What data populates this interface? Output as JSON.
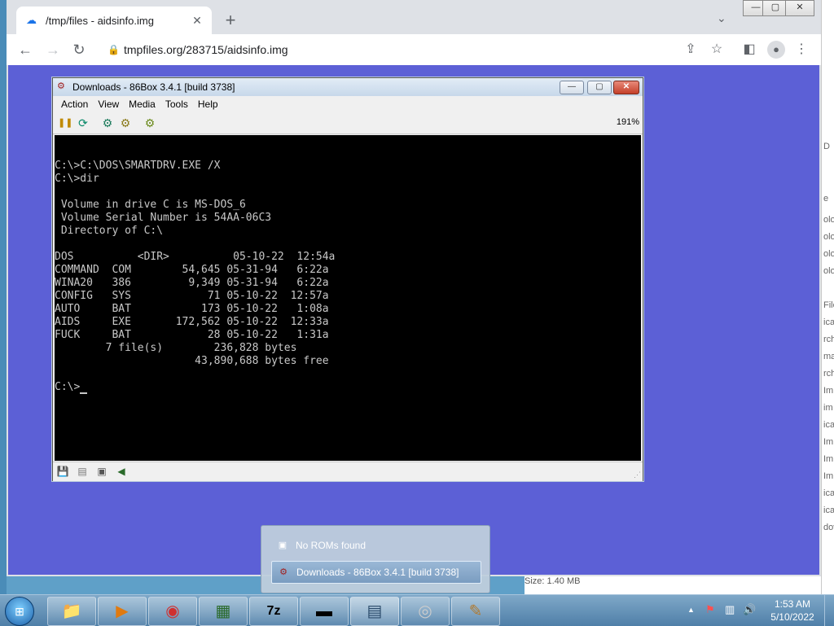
{
  "browser": {
    "tab_title": "/tmp/files - aidsinfo.img",
    "tab_close": "✕",
    "new_tab": "+",
    "tab_search": "⌄",
    "window_controls": {
      "minimize": "—",
      "maximize": "▢",
      "close": "✕"
    },
    "nav": {
      "back": "←",
      "forward": "→",
      "reload": "↻"
    },
    "url": "tmpfiles.org/283715/aidsinfo.img",
    "lock_icon": "🔒",
    "share_icon": "⇪",
    "star_icon": "☆",
    "sidepanel_icon": "◧",
    "avatar_icon": "●",
    "menu_icon": "⋮"
  },
  "emulator": {
    "title": "Downloads - 86Box 3.4.1 [build 3738]",
    "title_icon": "⚙",
    "title_buttons": {
      "minimize": "—",
      "maximize": "▢",
      "close": "✕"
    },
    "menu": [
      "Action",
      "View",
      "Media",
      "Tools",
      "Help"
    ],
    "toolbar_icons": {
      "pause": "❚❚",
      "reset": "⟳",
      "ctrl_alt_del": "⚙",
      "ctrl_alt_esc": "⚙",
      "settings": "⚙"
    },
    "zoom": "191%",
    "status_icons": {
      "floppy": "💾",
      "cdrom": "▤",
      "disk": "▣",
      "sound": "◀"
    },
    "grip": "⋰",
    "screen_lines": [
      "",
      "C:\\>C:\\DOS\\SMARTDRV.EXE /X",
      "C:\\>dir",
      "",
      " Volume in drive C is MS-DOS_6",
      " Volume Serial Number is 54AA-06C3",
      " Directory of C:\\",
      "",
      "DOS          <DIR>          05-10-22  12:54a",
      "COMMAND  COM        54,645 05-31-94   6:22a",
      "WINA20   386         9,349 05-31-94   6:22a",
      "CONFIG   SYS            71 05-10-22  12:57a",
      "AUTO     BAT           173 05-10-22   1:08a",
      "AIDS     EXE       172,562 05-10-22  12:33a",
      "FUCK     BAT            28 05-10-22   1:31a",
      "        7 file(s)        236,828 bytes",
      "                      43,890,688 bytes free",
      "",
      "C:\\>"
    ]
  },
  "taskbar_popup": {
    "items": [
      {
        "label": "No ROMs found",
        "icon": "▣",
        "selected": false
      },
      {
        "label": "Downloads - 86Box 3.4.1 [build 3738]",
        "icon": "⚙",
        "selected": true
      }
    ]
  },
  "taskbar": {
    "start_icon": "⊞",
    "buttons": [
      {
        "name": "explorer",
        "icon": "📁"
      },
      {
        "name": "media-player",
        "icon": "▶"
      },
      {
        "name": "chrome",
        "icon": "◉"
      },
      {
        "name": "network-monitor",
        "icon": "▦"
      },
      {
        "name": "7zip",
        "icon": "7z"
      },
      {
        "name": "command-prompt",
        "icon": "▬"
      },
      {
        "name": "86box",
        "icon": "▤"
      },
      {
        "name": "disc",
        "icon": "◎"
      },
      {
        "name": "paint",
        "icon": "✎"
      }
    ],
    "tray": {
      "arrow": "▲",
      "flag": "⚑",
      "network": "▥",
      "volume": "🔊"
    },
    "time": "1:53 AM",
    "date": "5/10/2022"
  },
  "background_window": {
    "fragments": [
      "D",
      "e",
      "olo",
      "olo",
      "olo",
      "olo",
      "File",
      "ica",
      "rch",
      "ma",
      "rch",
      "Im",
      "im",
      "ica",
      "Im",
      "Im",
      "Im",
      "ica",
      "ica",
      "dov"
    ],
    "size_text": "Size: 1.40 MB"
  }
}
